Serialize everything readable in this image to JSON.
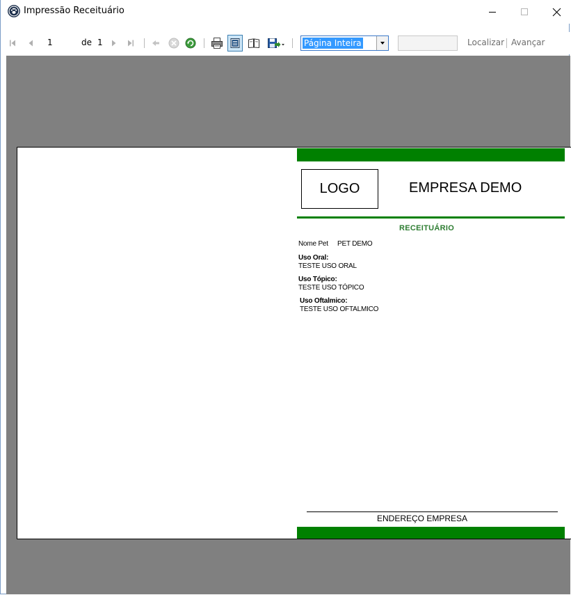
{
  "window": {
    "title": "Impressão Receituário",
    "minimize_icon": "minimize-icon",
    "maximize_icon": "maximize-icon",
    "close_icon": "close-icon"
  },
  "toolbar": {
    "current_page": "1",
    "of_label": "de",
    "total_pages": "1",
    "zoom_selected": "Página Inteira",
    "find_value": "",
    "find_label": "Localizar",
    "next_label": "Avançar",
    "icons": [
      "first-page-icon",
      "previous-page-icon",
      "next-page-icon",
      "last-page-icon",
      "back-icon",
      "stop-icon",
      "refresh-icon",
      "print-icon",
      "print-layout-icon",
      "page-setup-icon",
      "export-icon"
    ]
  },
  "report": {
    "logo_text": "LOGO",
    "company_name": "EMPRESA DEMO",
    "title": "RECEITUÁRIO",
    "pet_label": "Nome Pet",
    "pet_name": "PET DEMO",
    "oral_label": "Uso Oral:",
    "oral_text": "TESTE USO ORAL",
    "topical_label": "Uso Tópico:",
    "topical_text": "TESTE USO TÓPICO",
    "ophthalmic_label": "Uso Oftalmico:",
    "ophthalmic_text": "TESTE USO OFTALMICO",
    "address": "ENDEREÇO EMPRESA"
  },
  "colors": {
    "accent_green": "#008000",
    "preview_background": "#808080",
    "selection_blue": "#3399ff"
  }
}
